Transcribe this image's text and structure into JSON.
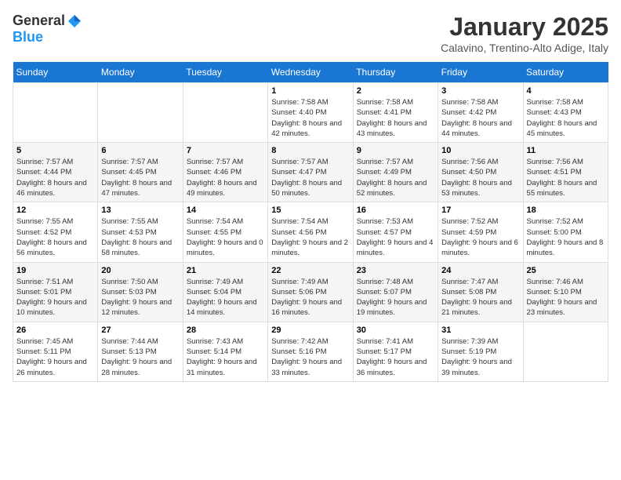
{
  "logo": {
    "general": "General",
    "blue": "Blue"
  },
  "header": {
    "month": "January 2025",
    "location": "Calavino, Trentino-Alto Adige, Italy"
  },
  "weekdays": [
    "Sunday",
    "Monday",
    "Tuesday",
    "Wednesday",
    "Thursday",
    "Friday",
    "Saturday"
  ],
  "weeks": [
    [
      {
        "day": "",
        "info": ""
      },
      {
        "day": "",
        "info": ""
      },
      {
        "day": "",
        "info": ""
      },
      {
        "day": "1",
        "info": "Sunrise: 7:58 AM\nSunset: 4:40 PM\nDaylight: 8 hours and 42 minutes."
      },
      {
        "day": "2",
        "info": "Sunrise: 7:58 AM\nSunset: 4:41 PM\nDaylight: 8 hours and 43 minutes."
      },
      {
        "day": "3",
        "info": "Sunrise: 7:58 AM\nSunset: 4:42 PM\nDaylight: 8 hours and 44 minutes."
      },
      {
        "day": "4",
        "info": "Sunrise: 7:58 AM\nSunset: 4:43 PM\nDaylight: 8 hours and 45 minutes."
      }
    ],
    [
      {
        "day": "5",
        "info": "Sunrise: 7:57 AM\nSunset: 4:44 PM\nDaylight: 8 hours and 46 minutes."
      },
      {
        "day": "6",
        "info": "Sunrise: 7:57 AM\nSunset: 4:45 PM\nDaylight: 8 hours and 47 minutes."
      },
      {
        "day": "7",
        "info": "Sunrise: 7:57 AM\nSunset: 4:46 PM\nDaylight: 8 hours and 49 minutes."
      },
      {
        "day": "8",
        "info": "Sunrise: 7:57 AM\nSunset: 4:47 PM\nDaylight: 8 hours and 50 minutes."
      },
      {
        "day": "9",
        "info": "Sunrise: 7:57 AM\nSunset: 4:49 PM\nDaylight: 8 hours and 52 minutes."
      },
      {
        "day": "10",
        "info": "Sunrise: 7:56 AM\nSunset: 4:50 PM\nDaylight: 8 hours and 53 minutes."
      },
      {
        "day": "11",
        "info": "Sunrise: 7:56 AM\nSunset: 4:51 PM\nDaylight: 8 hours and 55 minutes."
      }
    ],
    [
      {
        "day": "12",
        "info": "Sunrise: 7:55 AM\nSunset: 4:52 PM\nDaylight: 8 hours and 56 minutes."
      },
      {
        "day": "13",
        "info": "Sunrise: 7:55 AM\nSunset: 4:53 PM\nDaylight: 8 hours and 58 minutes."
      },
      {
        "day": "14",
        "info": "Sunrise: 7:54 AM\nSunset: 4:55 PM\nDaylight: 9 hours and 0 minutes."
      },
      {
        "day": "15",
        "info": "Sunrise: 7:54 AM\nSunset: 4:56 PM\nDaylight: 9 hours and 2 minutes."
      },
      {
        "day": "16",
        "info": "Sunrise: 7:53 AM\nSunset: 4:57 PM\nDaylight: 9 hours and 4 minutes."
      },
      {
        "day": "17",
        "info": "Sunrise: 7:52 AM\nSunset: 4:59 PM\nDaylight: 9 hours and 6 minutes."
      },
      {
        "day": "18",
        "info": "Sunrise: 7:52 AM\nSunset: 5:00 PM\nDaylight: 9 hours and 8 minutes."
      }
    ],
    [
      {
        "day": "19",
        "info": "Sunrise: 7:51 AM\nSunset: 5:01 PM\nDaylight: 9 hours and 10 minutes."
      },
      {
        "day": "20",
        "info": "Sunrise: 7:50 AM\nSunset: 5:03 PM\nDaylight: 9 hours and 12 minutes."
      },
      {
        "day": "21",
        "info": "Sunrise: 7:49 AM\nSunset: 5:04 PM\nDaylight: 9 hours and 14 minutes."
      },
      {
        "day": "22",
        "info": "Sunrise: 7:49 AM\nSunset: 5:06 PM\nDaylight: 9 hours and 16 minutes."
      },
      {
        "day": "23",
        "info": "Sunrise: 7:48 AM\nSunset: 5:07 PM\nDaylight: 9 hours and 19 minutes."
      },
      {
        "day": "24",
        "info": "Sunrise: 7:47 AM\nSunset: 5:08 PM\nDaylight: 9 hours and 21 minutes."
      },
      {
        "day": "25",
        "info": "Sunrise: 7:46 AM\nSunset: 5:10 PM\nDaylight: 9 hours and 23 minutes."
      }
    ],
    [
      {
        "day": "26",
        "info": "Sunrise: 7:45 AM\nSunset: 5:11 PM\nDaylight: 9 hours and 26 minutes."
      },
      {
        "day": "27",
        "info": "Sunrise: 7:44 AM\nSunset: 5:13 PM\nDaylight: 9 hours and 28 minutes."
      },
      {
        "day": "28",
        "info": "Sunrise: 7:43 AM\nSunset: 5:14 PM\nDaylight: 9 hours and 31 minutes."
      },
      {
        "day": "29",
        "info": "Sunrise: 7:42 AM\nSunset: 5:16 PM\nDaylight: 9 hours and 33 minutes."
      },
      {
        "day": "30",
        "info": "Sunrise: 7:41 AM\nSunset: 5:17 PM\nDaylight: 9 hours and 36 minutes."
      },
      {
        "day": "31",
        "info": "Sunrise: 7:39 AM\nSunset: 5:19 PM\nDaylight: 9 hours and 39 minutes."
      },
      {
        "day": "",
        "info": ""
      }
    ]
  ]
}
